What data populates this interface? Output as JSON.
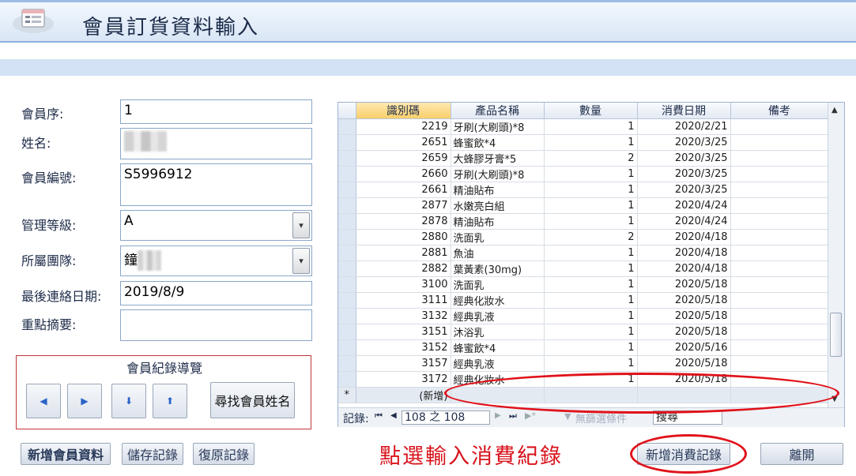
{
  "header": {
    "title": "會員訂貨資料輸入"
  },
  "form": {
    "fields": [
      {
        "label": "會員序:",
        "value": "1"
      },
      {
        "label": "姓名:",
        "value": ""
      },
      {
        "label": "會員編號:",
        "value": "S5996912"
      },
      {
        "label": "管理等級:",
        "value": "A"
      },
      {
        "label": "所屬團隊:",
        "value": "鐘"
      },
      {
        "label": "最後連絡日期:",
        "value": "2019/8/9"
      },
      {
        "label": "重點摘要:",
        "value": ""
      }
    ]
  },
  "navigation": {
    "title": "會員紀錄導覽",
    "search_button": "尋找會員姓名",
    "buttons": [
      "previous-record",
      "next-record",
      "down-record",
      "up-record"
    ]
  },
  "bottom_buttons": {
    "add_member": "新增會員資料",
    "save": "儲存記錄",
    "restore": "復原記錄",
    "add_purchase": "新增消費記錄",
    "exit": "離開"
  },
  "annotation": "點選輸入消費紀錄",
  "datasheet": {
    "columns": [
      "識別碼",
      "產品名稱",
      "數量",
      "消費日期",
      "備考"
    ],
    "rows": [
      [
        "2219",
        "牙刷(大刷頭)*8",
        "1",
        "2020/2/21",
        ""
      ],
      [
        "2651",
        "蜂蜜飲*4",
        "1",
        "2020/3/25",
        ""
      ],
      [
        "2659",
        "大蜂膠牙膏*5",
        "2",
        "2020/3/25",
        ""
      ],
      [
        "2660",
        "牙刷(大刷頭)*8",
        "1",
        "2020/3/25",
        ""
      ],
      [
        "2661",
        "精油貼布",
        "1",
        "2020/3/25",
        ""
      ],
      [
        "2877",
        "水嫩亮白組",
        "1",
        "2020/4/24",
        ""
      ],
      [
        "2878",
        "精油貼布",
        "1",
        "2020/4/24",
        ""
      ],
      [
        "2880",
        "洗面乳",
        "2",
        "2020/4/18",
        ""
      ],
      [
        "2881",
        "魚油",
        "1",
        "2020/4/18",
        ""
      ],
      [
        "2882",
        "葉黃素(30mg)",
        "1",
        "2020/4/18",
        ""
      ],
      [
        "3100",
        "洗面乳",
        "1",
        "2020/5/18",
        ""
      ],
      [
        "3111",
        "經典化妝水",
        "1",
        "2020/5/18",
        ""
      ],
      [
        "3132",
        "經典乳液",
        "1",
        "2020/5/18",
        ""
      ],
      [
        "3151",
        "沐浴乳",
        "1",
        "2020/5/18",
        ""
      ],
      [
        "3152",
        "蜂蜜飲*4",
        "1",
        "2020/5/16",
        ""
      ],
      [
        "3157",
        "經典乳液",
        "1",
        "2020/5/18",
        ""
      ],
      [
        "3172",
        "經典化妝水",
        "1",
        "2020/5/18",
        ""
      ]
    ],
    "new_row_marker": "*",
    "new_row_label": "(新增)",
    "record_nav": {
      "label": "記錄:",
      "position": "108 之 108",
      "filter_status": "無篩選條件",
      "search_placeholder": "搜尋"
    }
  }
}
